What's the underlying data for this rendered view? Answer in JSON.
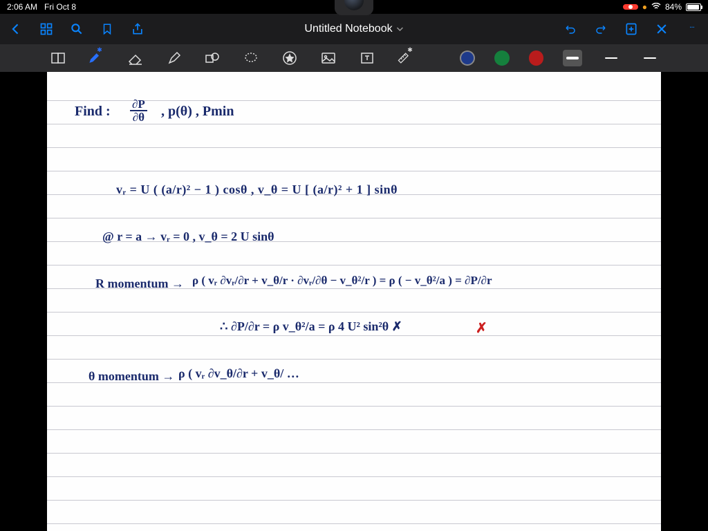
{
  "status": {
    "time": "2:06 AM",
    "date": "Fri Oct 8",
    "battery_pct": "84%"
  },
  "nav": {
    "title": "Untitled Notebook"
  },
  "toolbar": {
    "colors": {
      "blue": "#1e3a8a",
      "green": "#15803d",
      "red": "#b91c1c"
    }
  },
  "notes": {
    "line1_a": "Find :",
    "line1_b_num": "∂P",
    "line1_b_den": "∂θ",
    "line1_c": ",   p(θ) ,   Pmin",
    "line2": "vᵣ = U ( (a/r)² − 1 ) cosθ   ,   v_θ = U [ (a/r)² + 1 ] sinθ",
    "line3": "@ r = a  →   vᵣ = 0   ,   v_θ = 2 U sinθ",
    "line4a": "R momentum →",
    "line4b": "ρ ( vᵣ ∂vᵣ/∂r  +  v_θ/r · ∂vᵣ/∂θ  −  v_θ²/r )  =  ρ ( − v_θ²/a )  =  ∂P/∂r",
    "line5": "∴   ∂P/∂r  =  ρ v_θ²/a  =  ρ 4 U² sin²θ   ✗",
    "line6a": "θ momentum →",
    "line6b": "ρ ( vᵣ ∂v_θ/∂r  +  v_θ/ …"
  }
}
